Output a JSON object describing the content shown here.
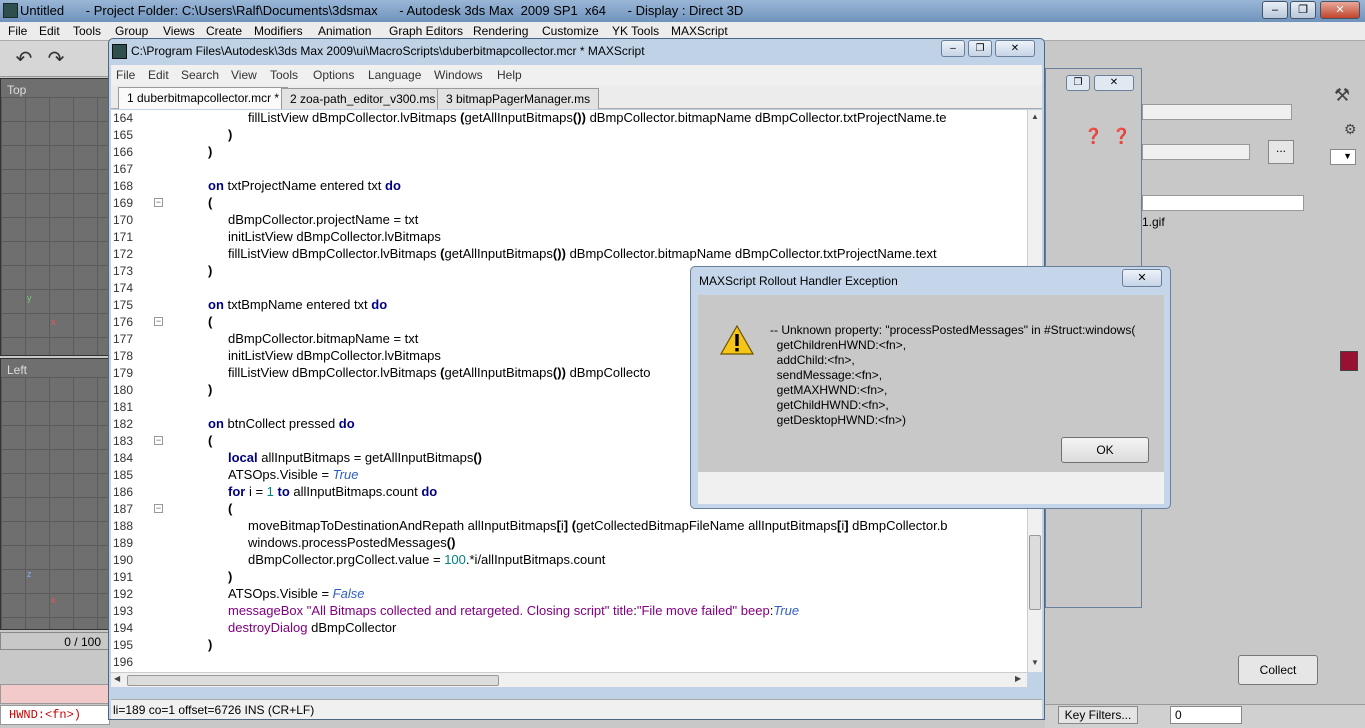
{
  "max_window": {
    "title": "Untitled      - Project Folder: C:\\Users\\Ralf\\Documents\\3dsmax      - Autodesk 3ds Max  2009 SP1  x64      - Display : Direct 3D",
    "menu": [
      "File",
      "Edit",
      "Tools",
      "Group",
      "Views",
      "Create",
      "Modifiers",
      "Animation",
      "Graph Editors",
      "Rendering",
      "Customize",
      "YK Tools",
      "MAXScript"
    ],
    "viewport_top_label": "Top",
    "viewport_left_label": "Left",
    "time_slider": "0 / 100",
    "listener_output": "HWND:<fn>)",
    "collect_label": "Collect",
    "key_filters_label": "Key Filters...",
    "frame_value": "0",
    "file_item": "1.gif",
    "browse_label": "...",
    "icons": {
      "undo": "undo-arrow-icon",
      "redo": "redo-arrow-icon",
      "hammer": "hammer-icon",
      "help": "help-icon"
    }
  },
  "editor": {
    "title": "C:\\Program Files\\Autodesk\\3ds Max 2009\\ui\\MacroScripts\\duberbitmapcollector.mcr * MAXScript",
    "menu": [
      "File",
      "Edit",
      "Search",
      "View",
      "Tools",
      "Options",
      "Language",
      "Windows",
      "Help"
    ],
    "tabs": [
      "1 duberbitmapcollector.mcr *",
      "2 zoa-path_editor_v300.ms",
      "3 bitmapPagerManager.ms"
    ],
    "status": "li=189 co=1 offset=6726 INS (CR+LF)",
    "lines": [
      {
        "n": "164",
        "text": "fillListView dBmpCollector.lvBitmaps (getAllInputBitmaps()) dBmpCollector.bitmapName dBmpCollector.txtProjectName.te"
      },
      {
        "n": "165",
        "text": ")"
      },
      {
        "n": "166",
        "text": ")"
      },
      {
        "n": "167",
        "text": ""
      },
      {
        "n": "168",
        "text": "on txtProjectName entered txt do"
      },
      {
        "n": "169",
        "text": "("
      },
      {
        "n": "170",
        "text": "dBmpCollector.projectName = txt"
      },
      {
        "n": "171",
        "text": "initListView dBmpCollector.lvBitmaps"
      },
      {
        "n": "172",
        "text": "fillListView dBmpCollector.lvBitmaps (getAllInputBitmaps()) dBmpCollector.bitmapName dBmpCollector.txtProjectName.text"
      },
      {
        "n": "173",
        "text": ")"
      },
      {
        "n": "174",
        "text": ""
      },
      {
        "n": "175",
        "text": "on txtBmpName entered txt do"
      },
      {
        "n": "176",
        "text": "("
      },
      {
        "n": "177",
        "text": "dBmpCollector.bitmapName = txt"
      },
      {
        "n": "178",
        "text": "initListView dBmpCollector.lvBitmaps"
      },
      {
        "n": "179",
        "text": "fillListView dBmpCollector.lvBitmaps (getAllInputBitmaps()) dBmpCollecto"
      },
      {
        "n": "180",
        "text": ")"
      },
      {
        "n": "181",
        "text": ""
      },
      {
        "n": "182",
        "text": "on btnCollect pressed do"
      },
      {
        "n": "183",
        "text": "("
      },
      {
        "n": "184",
        "text": "local allInputBitmaps = getAllInputBitmaps()"
      },
      {
        "n": "185",
        "text": "ATSOps.Visible = True"
      },
      {
        "n": "186",
        "text": "for i = 1 to allInputBitmaps.count do"
      },
      {
        "n": "187",
        "text": "("
      },
      {
        "n": "188",
        "text": "moveBitmapToDestinationAndRepath allInputBitmaps[i] (getCollectedBitmapFileName allInputBitmaps[i] dBmpCollector.b"
      },
      {
        "n": "189",
        "text": "windows.processPostedMessages()"
      },
      {
        "n": "190",
        "text": "dBmpCollector.prgCollect.value = 100.*i/allInputBitmaps.count"
      },
      {
        "n": "191",
        "text": ")"
      },
      {
        "n": "192",
        "text": "ATSOps.Visible = False"
      },
      {
        "n": "193",
        "text": "messageBox \"All Bitmaps collected and retargeted. Closing script\" title:\"File move failed\" beep:True"
      },
      {
        "n": "194",
        "text": "destroyDialog dBmpCollector"
      },
      {
        "n": "195",
        "text": ")"
      },
      {
        "n": "196",
        "text": ""
      }
    ]
  },
  "dialog": {
    "title": "MAXScript Rollout Handler Exception",
    "message": "-- Unknown property: \"processPostedMessages\" in #Struct:windows(\n  getChildrenHWND:<fn>,\n  addChild:<fn>,\n  sendMessage:<fn>,\n  getMAXHWND:<fn>,\n  getChildHWND:<fn>,\n  getDesktopHWND:<fn>)",
    "ok_label": "OK"
  }
}
